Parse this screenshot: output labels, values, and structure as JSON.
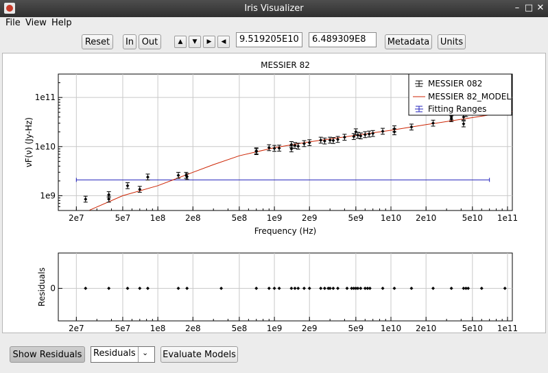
{
  "window": {
    "title": "Iris Visualizer"
  },
  "menu": [
    "File",
    "View",
    "Help"
  ],
  "toolbar": {
    "reset": "Reset",
    "zoom_in": "In",
    "zoom_out": "Out",
    "field1": "9.519205E10",
    "field2": "6.489309E8",
    "metadata": "Metadata",
    "units": "Units"
  },
  "bottom": {
    "show_residuals": "Show Residuals",
    "residuals_select": "Residuals",
    "evaluate_models": "Evaluate Models"
  },
  "chart_data": [
    {
      "type": "scatter",
      "title": "MESSIER 82",
      "xlabel": "Frequency (Hz)",
      "ylabel": "νF(ν) (Jy-Hz)",
      "xscale": "log",
      "yscale": "log",
      "xlim": [
        14000000,
        110000000000
      ],
      "ylim": [
        500000000,
        300000000000
      ],
      "x_ticks": [
        "2e7",
        "5e7",
        "1e8",
        "2e8",
        "5e8",
        "1e9",
        "2e9",
        "5e9",
        "1e10",
        "2e10",
        "5e10",
        "1e11"
      ],
      "y_ticks": [
        "1e9",
        "1e10",
        "1e11"
      ],
      "grid": true,
      "legend": "top-right",
      "legend_entries": [
        "MESSIER 082",
        "MESSIER 82_MODEL",
        "Fitting Ranges"
      ],
      "colors": {
        "data": "#000000",
        "model": "#cc2200",
        "range": "#2222bb"
      },
      "series": [
        {
          "name": "MESSIER 082",
          "points": [
            [
              24000000,
              850000000
            ],
            [
              38000000,
              1050000000
            ],
            [
              38000000,
              850000000
            ],
            [
              55000000,
              1600000000
            ],
            [
              70000000,
              1350000000
            ],
            [
              82000000,
              2400000000
            ],
            [
              150000000,
              2600000000
            ],
            [
              175000000,
              2600000000
            ],
            [
              178000000,
              2450000000
            ],
            [
              700000000,
              8200000000
            ],
            [
              700000000,
              7900000000
            ],
            [
              900000000,
              9500000000
            ],
            [
              1000000000,
              9200000000
            ],
            [
              1100000000,
              9300000000
            ],
            [
              1400000000,
              11000000000
            ],
            [
              1400000000,
              9000000000
            ],
            [
              1500000000,
              10500000000
            ],
            [
              1600000000,
              10200000000
            ],
            [
              1800000000,
              11500000000
            ],
            [
              2000000000,
              12000000000
            ],
            [
              2500000000,
              13500000000
            ],
            [
              2700000000,
              13000000000
            ],
            [
              3000000000,
              13500000000
            ],
            [
              3200000000,
              13300000000
            ],
            [
              3500000000,
              14000000000
            ],
            [
              4000000000,
              15500000000
            ],
            [
              4800000000,
              16000000000
            ],
            [
              5000000000,
              20000000000
            ],
            [
              5200000000,
              17000000000
            ],
            [
              5500000000,
              16500000000
            ],
            [
              6000000000,
              17500000000
            ],
            [
              6500000000,
              18000000000
            ],
            [
              7000000000,
              18500000000
            ],
            [
              8500000000,
              20500000000
            ],
            [
              10700000000,
              23000000000
            ],
            [
              10700000000,
              20000000000
            ],
            [
              15000000000,
              25000000000
            ],
            [
              23000000000,
              30000000000
            ],
            [
              33000000000,
              37000000000
            ],
            [
              33000000000,
              40000000000
            ],
            [
              42000000000,
              40000000000
            ],
            [
              42000000000,
              29000000000
            ],
            [
              44000000000,
              47000000000
            ],
            [
              60000000000,
              50000000000
            ],
            [
              95000000000,
              80000000000
            ],
            [
              95000000000,
              120000000000
            ]
          ]
        },
        {
          "name": "MESSIER 82_MODEL",
          "points": [
            [
              26000000,
              510000000
            ],
            [
              50000000,
              1000000000
            ],
            [
              100000000,
              1600000000
            ],
            [
              200000000,
              3000000000
            ],
            [
              300000000,
              4300000000
            ],
            [
              500000000,
              6500000000
            ],
            [
              1000000000,
              9500000000
            ],
            [
              2000000000,
              12500000000
            ],
            [
              5000000000,
              17000000000
            ],
            [
              10000000000,
              21500000000
            ],
            [
              20000000000,
              28000000000
            ],
            [
              50000000000,
              39000000000
            ],
            [
              110000000000,
              52000000000
            ]
          ]
        },
        {
          "name": "Fitting Ranges",
          "range": {
            "x": [
              20000000,
              70000000000
            ],
            "y": 2100000000
          }
        }
      ]
    },
    {
      "type": "scatter",
      "title": "",
      "xlabel": "",
      "ylabel": "Residuals",
      "xscale": "log",
      "xlim": [
        14000000,
        110000000000
      ],
      "y_ticks": [
        "0"
      ],
      "x_ticks": [
        "2e7",
        "5e7",
        "1e8",
        "2e8",
        "5e8",
        "1e9",
        "2e9",
        "5e9",
        "1e10",
        "2e10",
        "5e10",
        "1e11"
      ],
      "grid": true,
      "x": [
        24000000,
        38000000,
        55000000,
        70000000,
        82000000,
        150000000,
        178000000,
        350000000,
        700000000,
        900000000,
        1000000000,
        1100000000,
        1400000000,
        1500000000,
        1600000000,
        1800000000,
        2000000000,
        2500000000,
        2700000000,
        2900000000,
        3000000000,
        3200000000,
        3500000000,
        4200000000,
        4600000000,
        4800000000,
        5000000000,
        5200000000,
        5500000000,
        6000000000,
        6300000000,
        6600000000,
        8500000000,
        10700000000,
        15000000000,
        23000000000,
        33000000000,
        42000000000,
        44000000000,
        46000000000,
        60000000000,
        95000000000
      ],
      "y": 0
    }
  ]
}
